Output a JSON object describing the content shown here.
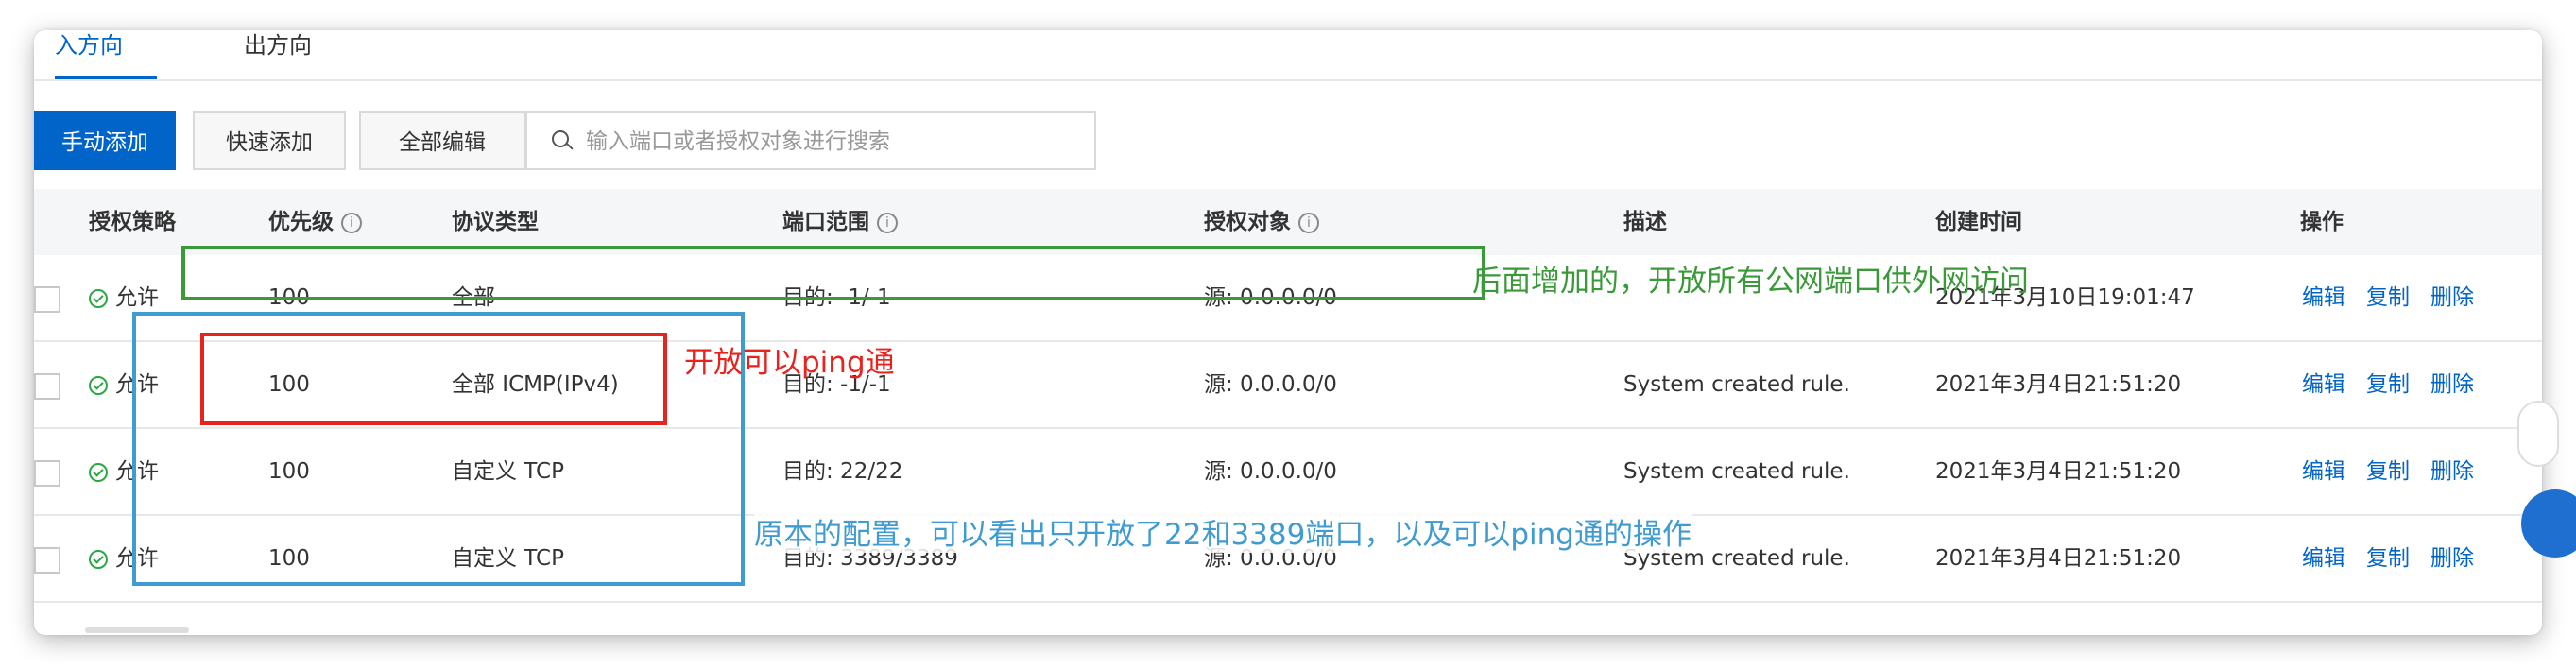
{
  "tabs": {
    "inbound": "入方向",
    "outbound": "出方向"
  },
  "toolbar": {
    "manual_add": "手动添加",
    "quick_add": "快速添加",
    "edit_all": "全部编辑",
    "search_placeholder": "输入端口或者授权对象进行搜索"
  },
  "table": {
    "headers": {
      "policy": "授权策略",
      "priority": "优先级",
      "protocol": "协议类型",
      "port_range": "端口范围",
      "auth_object": "授权对象",
      "description": "描述",
      "created_at": "创建时间",
      "actions": "操作"
    },
    "rows": [
      {
        "policy": "允许",
        "priority": "100",
        "protocol": "全部",
        "port_range": "目的: -1/-1",
        "auth_object": "源: 0.0.0.0/0",
        "description": "",
        "created_at": "2021年3月10日19:01:47"
      },
      {
        "policy": "允许",
        "priority": "100",
        "protocol": "全部 ICMP(IPv4)",
        "port_range": "目的: -1/-1",
        "auth_object": "源: 0.0.0.0/0",
        "description": "System created rule.",
        "created_at": "2021年3月4日21:51:20"
      },
      {
        "policy": "允许",
        "priority": "100",
        "protocol": "自定义 TCP",
        "port_range": "目的: 22/22",
        "auth_object": "源: 0.0.0.0/0",
        "description": "System created rule.",
        "created_at": "2021年3月4日21:51:20"
      },
      {
        "policy": "允许",
        "priority": "100",
        "protocol": "自定义 TCP",
        "port_range": "目的: 3389/3389",
        "auth_object": "源: 0.0.0.0/0",
        "description": "System created rule.",
        "created_at": "2021年3月4日21:51:20"
      }
    ],
    "actions": {
      "edit": "编辑",
      "copy": "复制",
      "delete": "删除"
    }
  },
  "annotations": {
    "green_note": "后面增加的，开放所有公网端口供外网访问",
    "red_note": "开放可以ping通",
    "blue_note": "原本的配置，可以看出只开放了22和3389端口，以及可以ping通的操作"
  },
  "colors": {
    "primary": "#0064c8",
    "green": "#3a9a3a",
    "red": "#e8231e",
    "blue": "#3f9bd0",
    "allow_green": "#2aa843"
  },
  "icons": {
    "search": "search-icon",
    "info": "info-icon",
    "allow": "check-circle-icon"
  }
}
